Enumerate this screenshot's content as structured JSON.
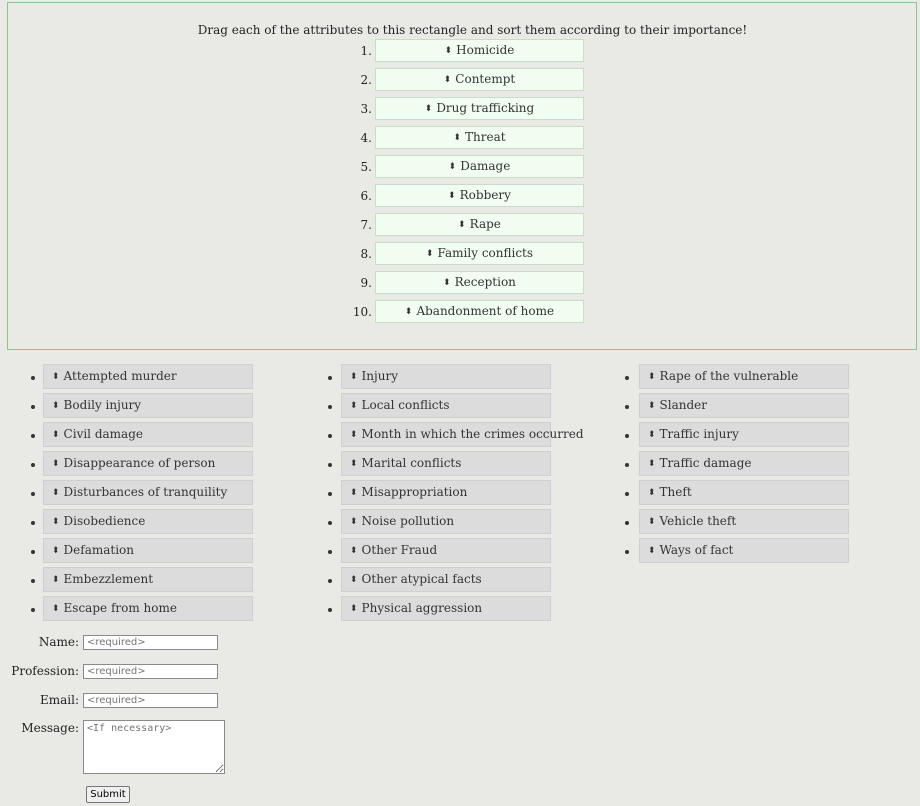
{
  "instruction": "Drag each of the attributes to this rectangle and sort them according to their importance!",
  "grip_icon": "⬍",
  "ranked": [
    {
      "num": "1.",
      "label": "Homicide"
    },
    {
      "num": "2.",
      "label": "Contempt"
    },
    {
      "num": "3.",
      "label": "Drug trafficking"
    },
    {
      "num": "4.",
      "label": "Threat"
    },
    {
      "num": "5.",
      "label": "Damage"
    },
    {
      "num": "6.",
      "label": "Robbery"
    },
    {
      "num": "7.",
      "label": "Rape"
    },
    {
      "num": "8.",
      "label": "Family conflicts"
    },
    {
      "num": "9.",
      "label": "Reception"
    },
    {
      "num": "10.",
      "label": "Abandonment of home"
    }
  ],
  "pool": {
    "col1": [
      "Attempted murder",
      "Bodily injury",
      "Civil damage",
      "Disappearance of person",
      "Disturbances of tranquility",
      "Disobedience",
      "Defamation",
      "Embezzlement",
      "Escape from home"
    ],
    "col2": [
      "Injury",
      "Local conflicts",
      "Month in which the crimes occurred",
      "Marital conflicts",
      "Misappropriation",
      "Noise pollution",
      "Other Fraud",
      "Other atypical facts",
      "Physical aggression"
    ],
    "col3": [
      "Rape of the vulnerable",
      "Slander",
      "Traffic injury",
      "Traffic damage",
      "Theft",
      "Vehicle theft",
      "Ways of fact"
    ]
  },
  "form": {
    "name_label": "Name:",
    "name_placeholder": "<required>",
    "profession_label": "Profession:",
    "profession_placeholder": "<required>",
    "email_label": "Email:",
    "email_placeholder": "<required>",
    "message_label": "Message:",
    "message_placeholder": "<If necessary>",
    "submit_label": "Submit"
  }
}
